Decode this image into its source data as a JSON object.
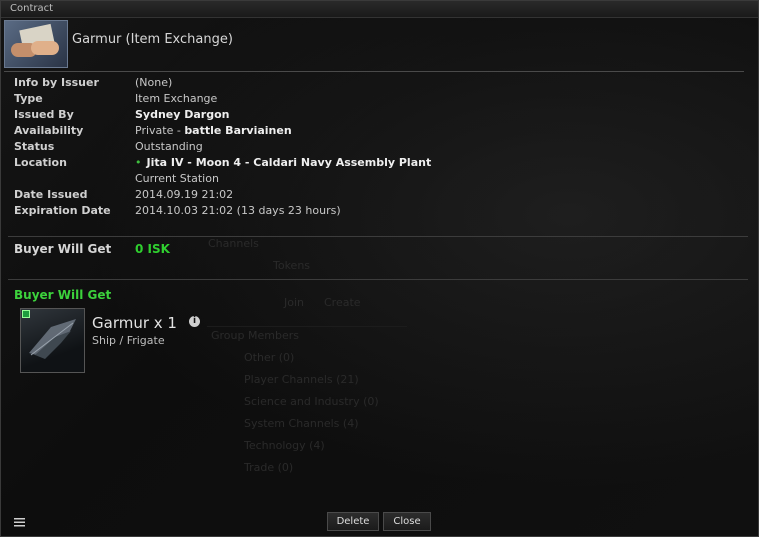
{
  "window": {
    "title": "Contract",
    "header_title": "Garmur (Item Exchange)"
  },
  "info_rows": [
    {
      "label": "Info by Issuer",
      "value": "(None)"
    },
    {
      "label": "Type",
      "value": "Item Exchange"
    },
    {
      "label": "Issued By",
      "value": "Sydney Dargon"
    },
    {
      "label": "Availability",
      "value_prefix": "Private - ",
      "value": "battle Barviainen"
    },
    {
      "label": "Status",
      "value": "Outstanding"
    },
    {
      "label": "Location",
      "value": "Jita IV - Moon 4 - Caldari Navy Assembly Plant"
    },
    {
      "label": "",
      "value": "Current Station"
    },
    {
      "label": "Date Issued",
      "value": "2014.09.19 21:02"
    },
    {
      "label": "Expiration Date",
      "value": "2014.10.03 21:02 (13 days 23 hours)"
    }
  ],
  "buyer_isk": {
    "label": "Buyer Will Get",
    "value": "0 ISK"
  },
  "buyer_items": {
    "label": "Buyer Will Get",
    "item_name": "Garmur x 1",
    "item_sub": "Ship / Frigate",
    "info_icon": "i"
  },
  "buttons": {
    "delete": "Delete",
    "close": "Close"
  },
  "background_ghost": {
    "channels": "Channels",
    "tokens": "Tokens",
    "join": "Join",
    "create": "Create",
    "group": "Group Members",
    "items": [
      "Other (0)",
      "Player Channels (21)",
      "Science and Industry (0)",
      "System Channels (4)",
      "Technology (4)",
      "Trade (0)"
    ]
  },
  "colors": {
    "accent_green": "#3cd23c",
    "isk_green": "#2fcf2f"
  },
  "icons": {
    "menu": "hamburger-menu-icon",
    "info": "info-icon",
    "location_dot": "location-dot-icon"
  }
}
